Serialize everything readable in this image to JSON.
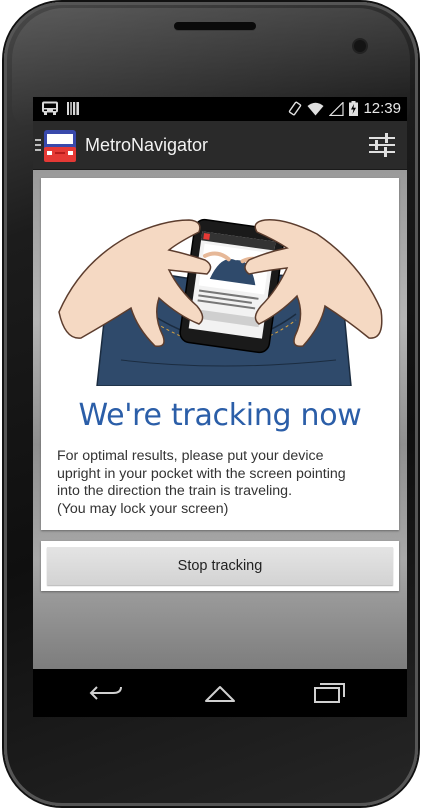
{
  "app": {
    "title": "MetroNavigator"
  },
  "status_bar": {
    "time": "12:39",
    "left_icons": [
      "bus-icon",
      "barcode-icon"
    ],
    "right_icons": [
      "rotate-icon",
      "wifi-icon",
      "signal-icon",
      "battery-charging-icon"
    ]
  },
  "action_bar": {
    "icons": [
      "drawer-indicator-icon",
      "app-train-icon",
      "settings-sliders-icon"
    ]
  },
  "tracking": {
    "heading": "We're tracking now",
    "instructions": [
      "For optimal results, please put your device",
      "upright in your pocket with the screen pointing",
      "into the direction the train is traveling.",
      "(You may lock your screen)"
    ],
    "stop_button_label": "Stop tracking"
  },
  "nav_bar": {
    "icons": [
      "back-icon",
      "home-icon",
      "recent-apps-icon"
    ]
  },
  "colors": {
    "accent": "#2b5ea8",
    "action_bar": "#2a2a2a",
    "app_icon_blue": "#3949ab",
    "app_icon_red": "#e53935",
    "jeans": "#2f4a6b"
  }
}
